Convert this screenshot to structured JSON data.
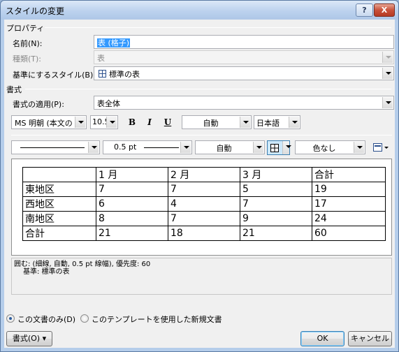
{
  "window": {
    "title": "スタイルの変更"
  },
  "titlebar": {
    "help_label": "?",
    "close_label": "X"
  },
  "properties": {
    "section_title": "プロパティ",
    "name_label": "名前(N):",
    "name_value": "表 (格子)",
    "type_label": "種類(T):",
    "type_value": "表",
    "base_label": "基準にするスタイル(B):",
    "base_value": "標準の表"
  },
  "format": {
    "section_title": "書式",
    "apply_label": "書式の適用(P):",
    "apply_value": "表全体",
    "font_name": "MS 明朝 (本文の",
    "font_size": "10.5",
    "bold_label": "B",
    "italic_label": "I",
    "underline_label": "U",
    "font_color": "自動",
    "language": "日本語",
    "border_width": "0.5 pt",
    "border_color": "自動",
    "shading": "色なし"
  },
  "preview_table": {
    "rows": [
      [
        "",
        "1 月",
        "2 月",
        "3 月",
        "合計"
      ],
      [
        "東地区",
        "7",
        "7",
        "5",
        "19"
      ],
      [
        "西地区",
        "6",
        "4",
        "7",
        "17"
      ],
      [
        "南地区",
        "8",
        "7",
        "9",
        "24"
      ],
      [
        "合計",
        "21",
        "18",
        "21",
        "60"
      ]
    ]
  },
  "description": {
    "line1": "囲む: (細線, 自動,  0.5 pt 線幅), 優先度: 60",
    "line2": "基準: 標準の表"
  },
  "scope": {
    "this_doc_label": "この文書のみ(D)",
    "template_label": "このテンプレートを使用した新規文書",
    "selected": "this_doc"
  },
  "buttons": {
    "format_label": "書式(O) ▾",
    "ok_label": "OK",
    "cancel_label": "キャンセル"
  },
  "colors": {
    "accent": "#3399ff",
    "titlebar": "#bcd2ee"
  }
}
